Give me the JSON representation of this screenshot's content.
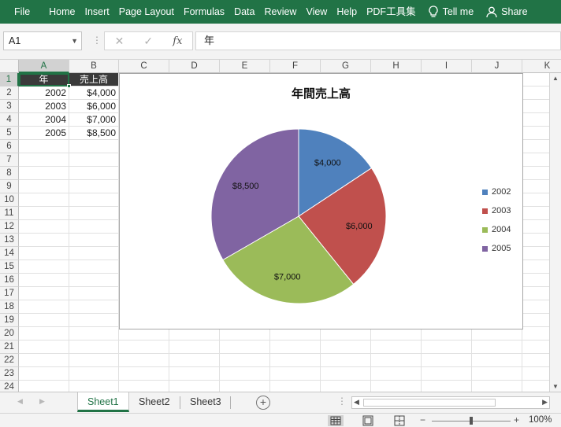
{
  "ribbon": {
    "tabs": [
      "File",
      "Home",
      "Insert",
      "Page Layout",
      "Formulas",
      "Data",
      "Review",
      "View",
      "Help",
      "PDF工具集"
    ],
    "tell_me": "Tell me",
    "share": "Share",
    "bg_color": "#217346"
  },
  "formula_bar": {
    "name_box": "A1",
    "fx_label": "fx",
    "content": "年"
  },
  "grid": {
    "columns": [
      "A",
      "B",
      "C",
      "D",
      "E",
      "F",
      "G",
      "H",
      "I",
      "J",
      "K"
    ],
    "rows": [
      "1",
      "2",
      "3",
      "4",
      "5",
      "6",
      "7",
      "8",
      "9",
      "10",
      "11",
      "12",
      "13",
      "14",
      "15",
      "16",
      "17",
      "18",
      "19",
      "20",
      "21",
      "22",
      "23",
      "24"
    ],
    "cells": {
      "A1": "年",
      "B1": "売上高",
      "A2": "2002",
      "B2": "$4,000",
      "A3": "2003",
      "B3": "$6,000",
      "A4": "2004",
      "B4": "$7,000",
      "A5": "2005",
      "B5": "$8,500"
    }
  },
  "chart_data": {
    "type": "pie",
    "title": "年間売上高",
    "categories": [
      "2002",
      "2003",
      "2004",
      "2005"
    ],
    "values": [
      4000,
      6000,
      7000,
      8500
    ],
    "data_labels": [
      "$4,000",
      "$6,000",
      "$7,000",
      "$8,500"
    ],
    "colors": [
      "#4f81bd",
      "#c0504d",
      "#9bbb59",
      "#8064a2"
    ],
    "legend_position": "right"
  },
  "sheet_tabs": {
    "tabs": [
      "Sheet1",
      "Sheet2",
      "Sheet3"
    ],
    "active": "Sheet1"
  },
  "status": {
    "zoom": "100%",
    "zoom_minus": "−",
    "zoom_plus": "+"
  }
}
